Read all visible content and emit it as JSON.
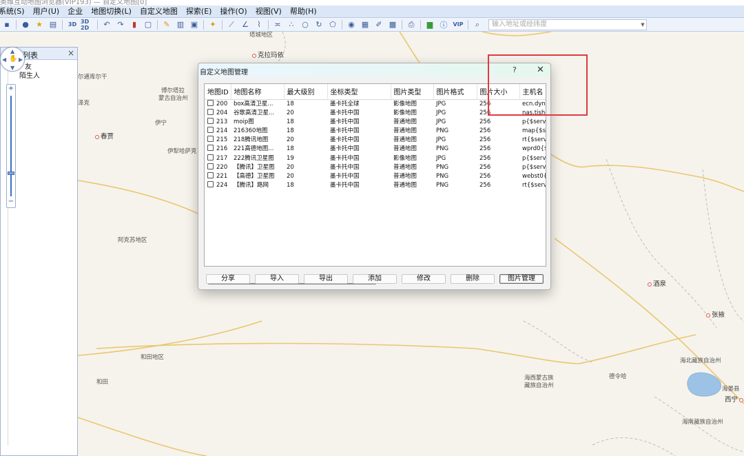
{
  "window": {
    "title": "奥维互动地图浏览器(VIP193) — 自定义地图[0]"
  },
  "menu": [
    "系统(S)",
    "用户(U)",
    "企业",
    "地图切换(L)",
    "自定义地图",
    "探索(E)",
    "操作(O)",
    "视图(V)",
    "帮助(H)"
  ],
  "toolbar": {
    "btn_3d": "3D",
    "btn_3d2d": "3D 2D",
    "btn_vip": "VIP",
    "search_placeholder": "输入地址或经纬度"
  },
  "left_panel": {
    "title": "列表",
    "close": "×",
    "items": [
      "友",
      "陌生人"
    ]
  },
  "zoom": {
    "plus": "+",
    "minus": "−"
  },
  "map_labels": [
    {
      "text": "塔城地区"
    },
    {
      "text": "克拉玛依",
      "capital": true
    },
    {
      "text": "尔逋库尔干"
    },
    {
      "text": "博尔塔拉"
    },
    {
      "text": "蒙古自治州"
    },
    {
      "text": "泽克"
    },
    {
      "text": "伊宁"
    },
    {
      "text": "春贾",
      "capital": true
    },
    {
      "text": "伊犁哈萨克"
    },
    {
      "text": "阿克苏地区"
    },
    {
      "text": "和田地区"
    },
    {
      "text": "和田"
    },
    {
      "text": "酒泉",
      "capital": true
    },
    {
      "text": "张掖",
      "capital": true
    },
    {
      "text": "海北藏族自治州"
    },
    {
      "text": "德令哈"
    },
    {
      "text": "海西蒙古族"
    },
    {
      "text": "藏族自治州"
    },
    {
      "text": "海晏县"
    },
    {
      "text": "西宁",
      "capital": true
    },
    {
      "text": "海南藏族自治州"
    }
  ],
  "dialog": {
    "title": "自定义地图管理",
    "help": "?",
    "close": "✕",
    "columns": [
      "地图ID",
      "地图名称",
      "最大级别",
      "坐标类型",
      "图片类型",
      "图片格式",
      "图片大小",
      "主机名"
    ],
    "rows": [
      {
        "id": "200",
        "name": "box高清卫星...",
        "max": "18",
        "coord": "墨卡托全球",
        "type": "影像地图",
        "fmt": "JPG",
        "size": "256",
        "host": "ecn.dyna"
      },
      {
        "id": "204",
        "name": "谷歌高清卫星...",
        "max": "20",
        "coord": "墨卡托中国",
        "type": "影像地图",
        "fmt": "JPG",
        "size": "256",
        "host": "nas.tishc"
      },
      {
        "id": "213",
        "name": "moip图",
        "max": "18",
        "coord": "墨卡托中国",
        "type": "普通地图",
        "fmt": "JPG",
        "size": "256",
        "host": "p{$serve"
      },
      {
        "id": "214",
        "name": "216360地图",
        "max": "18",
        "coord": "墨卡托中国",
        "type": "普通地图",
        "fmt": "PNG",
        "size": "256",
        "host": "map{$se"
      },
      {
        "id": "215",
        "name": "218腾讯地图",
        "max": "20",
        "coord": "墨卡托中国",
        "type": "普通地图",
        "fmt": "JPG",
        "size": "256",
        "host": "rt{$serve"
      },
      {
        "id": "216",
        "name": "221高德地图...",
        "max": "18",
        "coord": "墨卡托中国",
        "type": "普通地图",
        "fmt": "PNG",
        "size": "256",
        "host": "wprd0{$"
      },
      {
        "id": "217",
        "name": "222腾讯卫星图",
        "max": "19",
        "coord": "墨卡托中国",
        "type": "影像地图",
        "fmt": "JPG",
        "size": "256",
        "host": "p{$serve"
      },
      {
        "id": "220",
        "name": "【腾讯】卫星图",
        "max": "20",
        "coord": "墨卡托中国",
        "type": "普通地图",
        "fmt": "PNG",
        "size": "256",
        "host": "p{$serve"
      },
      {
        "id": "221",
        "name": "【高德】卫星图",
        "max": "20",
        "coord": "墨卡托中国",
        "type": "普通地图",
        "fmt": "PNG",
        "size": "256",
        "host": "webst0{"
      },
      {
        "id": "224",
        "name": "【腾讯】路网",
        "max": "18",
        "coord": "墨卡托中国",
        "type": "普通地图",
        "fmt": "PNG",
        "size": "256",
        "host": "rt{$serve"
      }
    ],
    "buttons": [
      "分享",
      "导入",
      "导出",
      "添加",
      "修改",
      "删除",
      "图片管理"
    ]
  },
  "colors": {
    "annotation": "#e0393f",
    "accent": "#3a6fc7",
    "border_line": "#e5c46b"
  }
}
